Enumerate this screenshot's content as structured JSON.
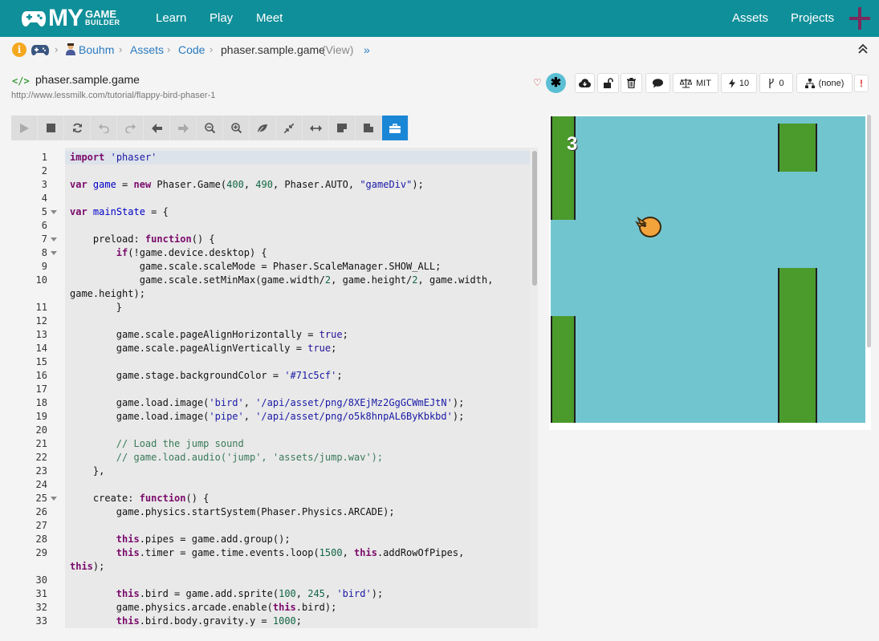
{
  "nav": {
    "logo_my": "MY",
    "logo_game": "GAME",
    "logo_builder": "BUILDER",
    "links": [
      "Learn",
      "Play",
      "Meet"
    ],
    "right_links": [
      "Assets",
      "Projects"
    ],
    "bg_color": "#0f8f99"
  },
  "breadcrumb": {
    "user": "Bouhm",
    "assets": "Assets",
    "code": "Code",
    "file": "phaser.sample.game",
    "mode": "(View)",
    "more": "»"
  },
  "project": {
    "icon": "</>",
    "title": "phaser.sample.game",
    "url": "http://www.lessmilk.com/tutorial/flappy-bird-phaser-1"
  },
  "actions": {
    "license": "MIT",
    "plays": "10",
    "forks": "0",
    "parent": "(none)",
    "alert": "!"
  },
  "editor": {
    "lines": [
      {
        "n": "1",
        "html": "<span class='kw'>import</span> <span class='str'>'phaser'</span>",
        "hl": true
      },
      {
        "n": "2",
        "html": ""
      },
      {
        "n": "3",
        "html": "<span class='kw'>var</span> <span class='def'>game</span> = <span class='kw'>new</span> Phaser.Game(<span class='num'>400</span>, <span class='num'>490</span>, Phaser.AUTO, <span class='str'>\"gameDiv\"</span>);"
      },
      {
        "n": "4",
        "html": ""
      },
      {
        "n": "5",
        "html": "<span class='kw'>var</span> <span class='def'>mainState</span> = {",
        "fold": true
      },
      {
        "n": "6",
        "html": ""
      },
      {
        "n": "7",
        "html": "    preload: <span class='kw'>function</span>() {",
        "fold": true
      },
      {
        "n": "8",
        "html": "        <span class='kw'>if</span>(!game.device.desktop) {",
        "fold": true
      },
      {
        "n": "9",
        "html": "            game.scale.scaleMode = Phaser.ScaleManager.SHOW_ALL;"
      },
      {
        "n": "10",
        "html": "            game.scale.setMinMax(game.width/<span class='num'>2</span>, game.height/<span class='num'>2</span>, game.width,"
      },
      {
        "n": "",
        "html": "game.height);"
      },
      {
        "n": "11",
        "html": "        }"
      },
      {
        "n": "12",
        "html": ""
      },
      {
        "n": "13",
        "html": "        game.scale.pageAlignHorizontally = <span class='bool'>true</span>;"
      },
      {
        "n": "14",
        "html": "        game.scale.pageAlignVertically = <span class='bool'>true</span>;"
      },
      {
        "n": "15",
        "html": ""
      },
      {
        "n": "16",
        "html": "        game.stage.backgroundColor = <span class='str'>'#71c5cf'</span>;"
      },
      {
        "n": "17",
        "html": ""
      },
      {
        "n": "18",
        "html": "        game.load.image(<span class='str'>'bird'</span>, <span class='str'>'/api/asset/png/8XEjMz2GgGCWmEJtN'</span>);"
      },
      {
        "n": "19",
        "html": "        game.load.image(<span class='str'>'pipe'</span>, <span class='str'>'/api/asset/png/o5k8hnpAL6ByKbkbd'</span>);"
      },
      {
        "n": "20",
        "html": ""
      },
      {
        "n": "21",
        "html": "        <span class='cmt'>// Load the jump sound</span>"
      },
      {
        "n": "22",
        "html": "        <span class='cmt'>// game.load.audio('jump', 'assets/jump.wav');</span>"
      },
      {
        "n": "23",
        "html": "    },"
      },
      {
        "n": "24",
        "html": ""
      },
      {
        "n": "25",
        "html": "    create: <span class='kw'>function</span>() {",
        "fold": true
      },
      {
        "n": "26",
        "html": "        game.physics.startSystem(Phaser.Physics.ARCADE);"
      },
      {
        "n": "27",
        "html": ""
      },
      {
        "n": "28",
        "html": "        <span class='kw'>this</span>.pipes = game.add.group();"
      },
      {
        "n": "29",
        "html": "        <span class='kw'>this</span>.timer = game.time.events.loop(<span class='num'>1500</span>, <span class='kw'>this</span>.addRowOfPipes,"
      },
      {
        "n": "",
        "html": "<span class='kw'>this</span>);"
      },
      {
        "n": "30",
        "html": ""
      },
      {
        "n": "31",
        "html": "        <span class='kw'>this</span>.bird = game.add.sprite(<span class='num'>100</span>, <span class='num'>245</span>, <span class='str'>'bird'</span>);"
      },
      {
        "n": "32",
        "html": "        game.physics.arcade.enable(<span class='kw'>this</span>.bird);"
      },
      {
        "n": "33",
        "html": "        <span class='kw'>this</span>.bird.body.gravity.y = <span class='num'>1000</span>;"
      }
    ]
  },
  "game": {
    "score": "3",
    "bg_color": "#71c5cf",
    "pipe_color": "#4b9a2c"
  }
}
